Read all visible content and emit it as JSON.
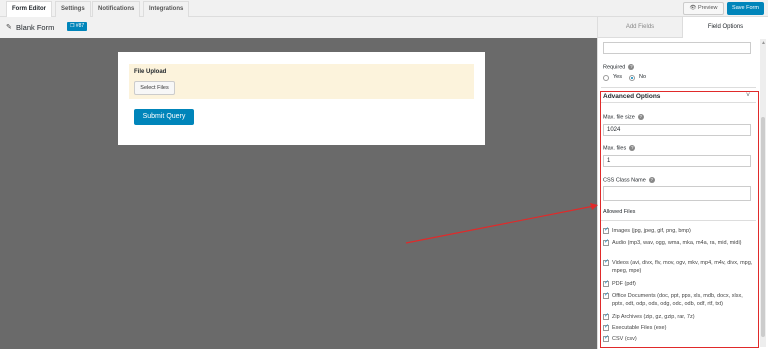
{
  "topbar": {
    "tabs": [
      "Form Editor",
      "Settings",
      "Notifications",
      "Integrations"
    ],
    "preview_label": "Preview",
    "save_label": "Save Form"
  },
  "form": {
    "title": "Blank Form",
    "id_badge": "#87",
    "field_label": "File Upload",
    "select_files_label": "Select Files",
    "submit_label": "Submit Query"
  },
  "panel": {
    "tabs": [
      "Add Fields",
      "Field Options"
    ],
    "required_label": "Required",
    "required_yes": "Yes",
    "required_no": "No",
    "advanced_title": "Advanced Options",
    "max_file_size_label": "Max. file size",
    "max_file_size_value": "1024",
    "max_files_label": "Max. files",
    "max_files_value": "1",
    "css_class_label": "CSS Class Name",
    "css_class_value": "",
    "allowed_files_label": "Allowed Files",
    "allowed_files": [
      "Images (jpg, jpeg, gif, png, bmp)",
      "Audio (mp3, wav, ogg, wma, mka, m4a, ra, mid, midi)",
      "Videos (avi, divx, flv, mov, ogv, mkv, mp4, m4v, divx, mpg, mpeg, mpe)",
      "PDF (pdf)",
      "Office Documents (doc, ppt, pps, xls, mdb, docx, xlsx, pptx, odt, odp, ods, odg, odc, odb, odf, rtf, txt)",
      "Zip Archives (zip, gz, gzip, rar, 7z)",
      "Executable Files (exe)",
      "CSV (csv)"
    ]
  },
  "colors": {
    "accent": "#0085ba",
    "highlight": "#e02a2a"
  }
}
